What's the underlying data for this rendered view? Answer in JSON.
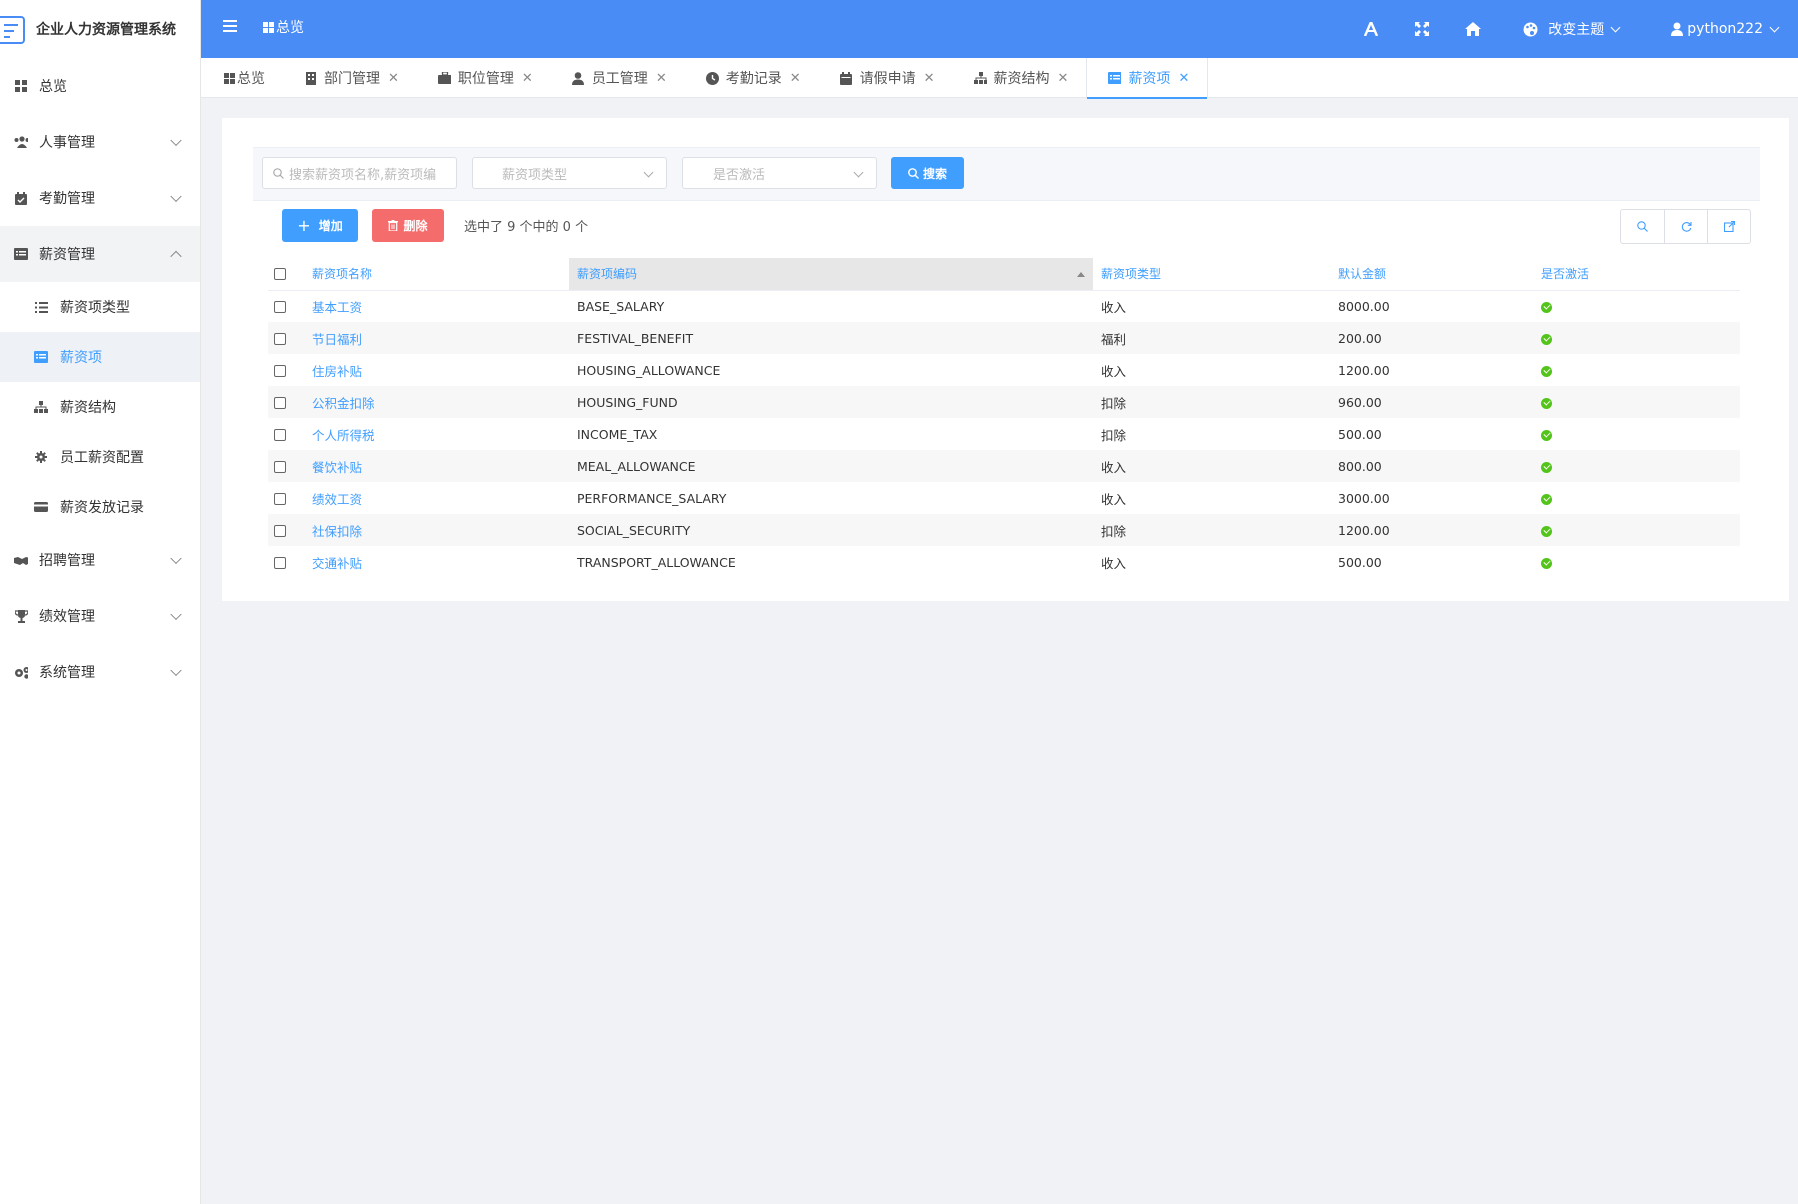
{
  "app": {
    "title": "企业人力资源管理系统"
  },
  "header": {
    "breadcrumb": "总览",
    "theme_label": "改变主题",
    "user_name": "python222"
  },
  "sidebar": {
    "items": [
      {
        "label": "总览",
        "icon": "dashboard-icon"
      },
      {
        "label": "人事管理",
        "icon": "users-icon"
      },
      {
        "label": "考勤管理",
        "icon": "calendar-check-icon"
      },
      {
        "label": "薪资管理",
        "icon": "list-alt-icon"
      },
      {
        "label": "招聘管理",
        "icon": "handshake-icon"
      },
      {
        "label": "绩效管理",
        "icon": "trophy-icon"
      },
      {
        "label": "系统管理",
        "icon": "cogs-icon"
      }
    ],
    "sub_items": [
      {
        "label": "薪资项类型",
        "icon": "list-icon"
      },
      {
        "label": "薪资项",
        "icon": "list-alt-icon"
      },
      {
        "label": "薪资结构",
        "icon": "sitemap-icon"
      },
      {
        "label": "员工薪资配置",
        "icon": "gear-icon"
      },
      {
        "label": "薪资发放记录",
        "icon": "credit-card-icon"
      }
    ]
  },
  "tabs": [
    {
      "label": "总览",
      "closable": false
    },
    {
      "label": "部门管理",
      "closable": true
    },
    {
      "label": "职位管理",
      "closable": true
    },
    {
      "label": "员工管理",
      "closable": true
    },
    {
      "label": "考勤记录",
      "closable": true
    },
    {
      "label": "请假申请",
      "closable": true
    },
    {
      "label": "薪资结构",
      "closable": true
    },
    {
      "label": "薪资项",
      "closable": true
    }
  ],
  "filters": {
    "search_placeholder": "搜索薪资项名称,薪资项编",
    "type_placeholder": "薪资项类型",
    "active_placeholder": "是否激活",
    "search_button": "搜索"
  },
  "toolbar": {
    "add_label": "增加",
    "delete_label": "删除",
    "selection_info": "选中了 9 个中的 0 个"
  },
  "table": {
    "columns": [
      "薪资项名称",
      "薪资项编码",
      "薪资项类型",
      "默认金额",
      "是否激活"
    ],
    "rows": [
      {
        "name": "基本工资",
        "code": "BASE_SALARY",
        "type": "收入",
        "amount": "8000.00",
        "active": true
      },
      {
        "name": "节日福利",
        "code": "FESTIVAL_BENEFIT",
        "type": "福利",
        "amount": "200.00",
        "active": true
      },
      {
        "name": "住房补贴",
        "code": "HOUSING_ALLOWANCE",
        "type": "收入",
        "amount": "1200.00",
        "active": true
      },
      {
        "name": "公积金扣除",
        "code": "HOUSING_FUND",
        "type": "扣除",
        "amount": "960.00",
        "active": true
      },
      {
        "name": "个人所得税",
        "code": "INCOME_TAX",
        "type": "扣除",
        "amount": "500.00",
        "active": true
      },
      {
        "name": "餐饮补贴",
        "code": "MEAL_ALLOWANCE",
        "type": "收入",
        "amount": "800.00",
        "active": true
      },
      {
        "name": "绩效工资",
        "code": "PERFORMANCE_SALARY",
        "type": "收入",
        "amount": "3000.00",
        "active": true
      },
      {
        "name": "社保扣除",
        "code": "SOCIAL_SECURITY",
        "type": "扣除",
        "amount": "1200.00",
        "active": true
      },
      {
        "name": "交通补贴",
        "code": "TRANSPORT_ALLOWANCE",
        "type": "收入",
        "amount": "500.00",
        "active": true
      }
    ]
  },
  "colors": {
    "header": "#4a8cf5",
    "accent": "#409eff",
    "danger": "#f56c6c",
    "success": "#52c41a"
  }
}
